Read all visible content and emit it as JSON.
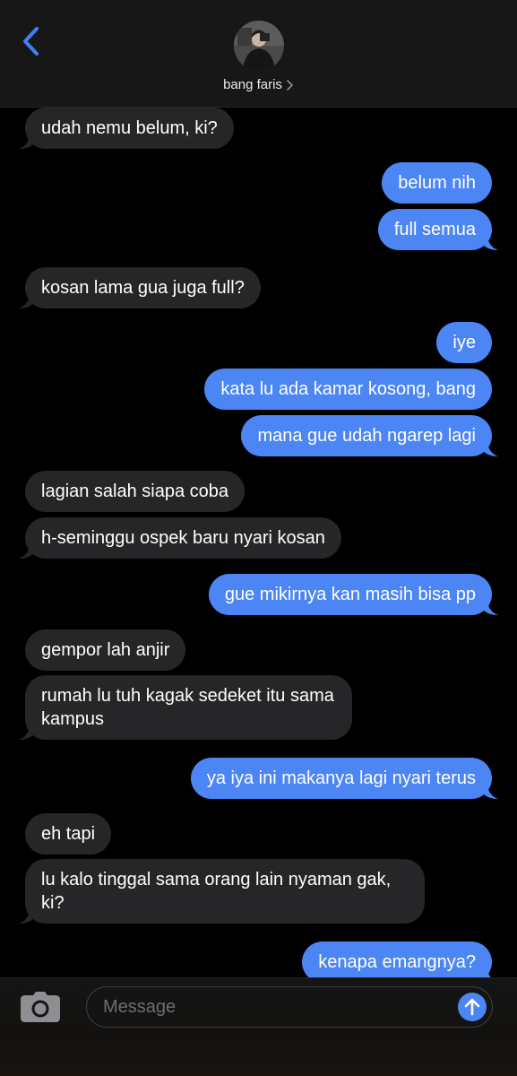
{
  "header": {
    "contact_name": "bang faris"
  },
  "messages": [
    {
      "side": "in",
      "text": "udah nemu belum, ki?"
    },
    {
      "side": "out",
      "text": "belum nih"
    },
    {
      "side": "out",
      "text": "full semua"
    },
    {
      "side": "in",
      "text": "kosan lama gua juga full?"
    },
    {
      "side": "out",
      "text": "iye"
    },
    {
      "side": "out",
      "text": "kata lu ada kamar kosong, bang"
    },
    {
      "side": "out",
      "text": "mana gue udah ngarep lagi"
    },
    {
      "side": "in",
      "text": "lagian salah siapa coba"
    },
    {
      "side": "in",
      "text": "h-seminggu ospek baru nyari kosan"
    },
    {
      "side": "out",
      "text": "gue mikirnya kan masih bisa pp"
    },
    {
      "side": "in",
      "text": "gempor lah anjir"
    },
    {
      "side": "in",
      "text": "rumah lu tuh kagak sedeket itu sama kampus"
    },
    {
      "side": "out",
      "text": "ya iya ini makanya lagi nyari terus"
    },
    {
      "side": "in",
      "text": "eh tapi"
    },
    {
      "side": "in",
      "text": "lu kalo tinggal sama orang lain nyaman gak, ki?"
    },
    {
      "side": "out",
      "text": "kenapa emangnya?"
    }
  ],
  "composer": {
    "placeholder": "Message",
    "value": ""
  },
  "colors": {
    "incoming_bubble": "#262628",
    "outgoing_bubble": "#4c86f4",
    "accent": "#3b82f6"
  },
  "icons": {
    "back": "chevron-left-icon",
    "contact_chevron": "chevron-right-icon",
    "camera": "camera-icon",
    "send": "arrow-up-icon"
  }
}
